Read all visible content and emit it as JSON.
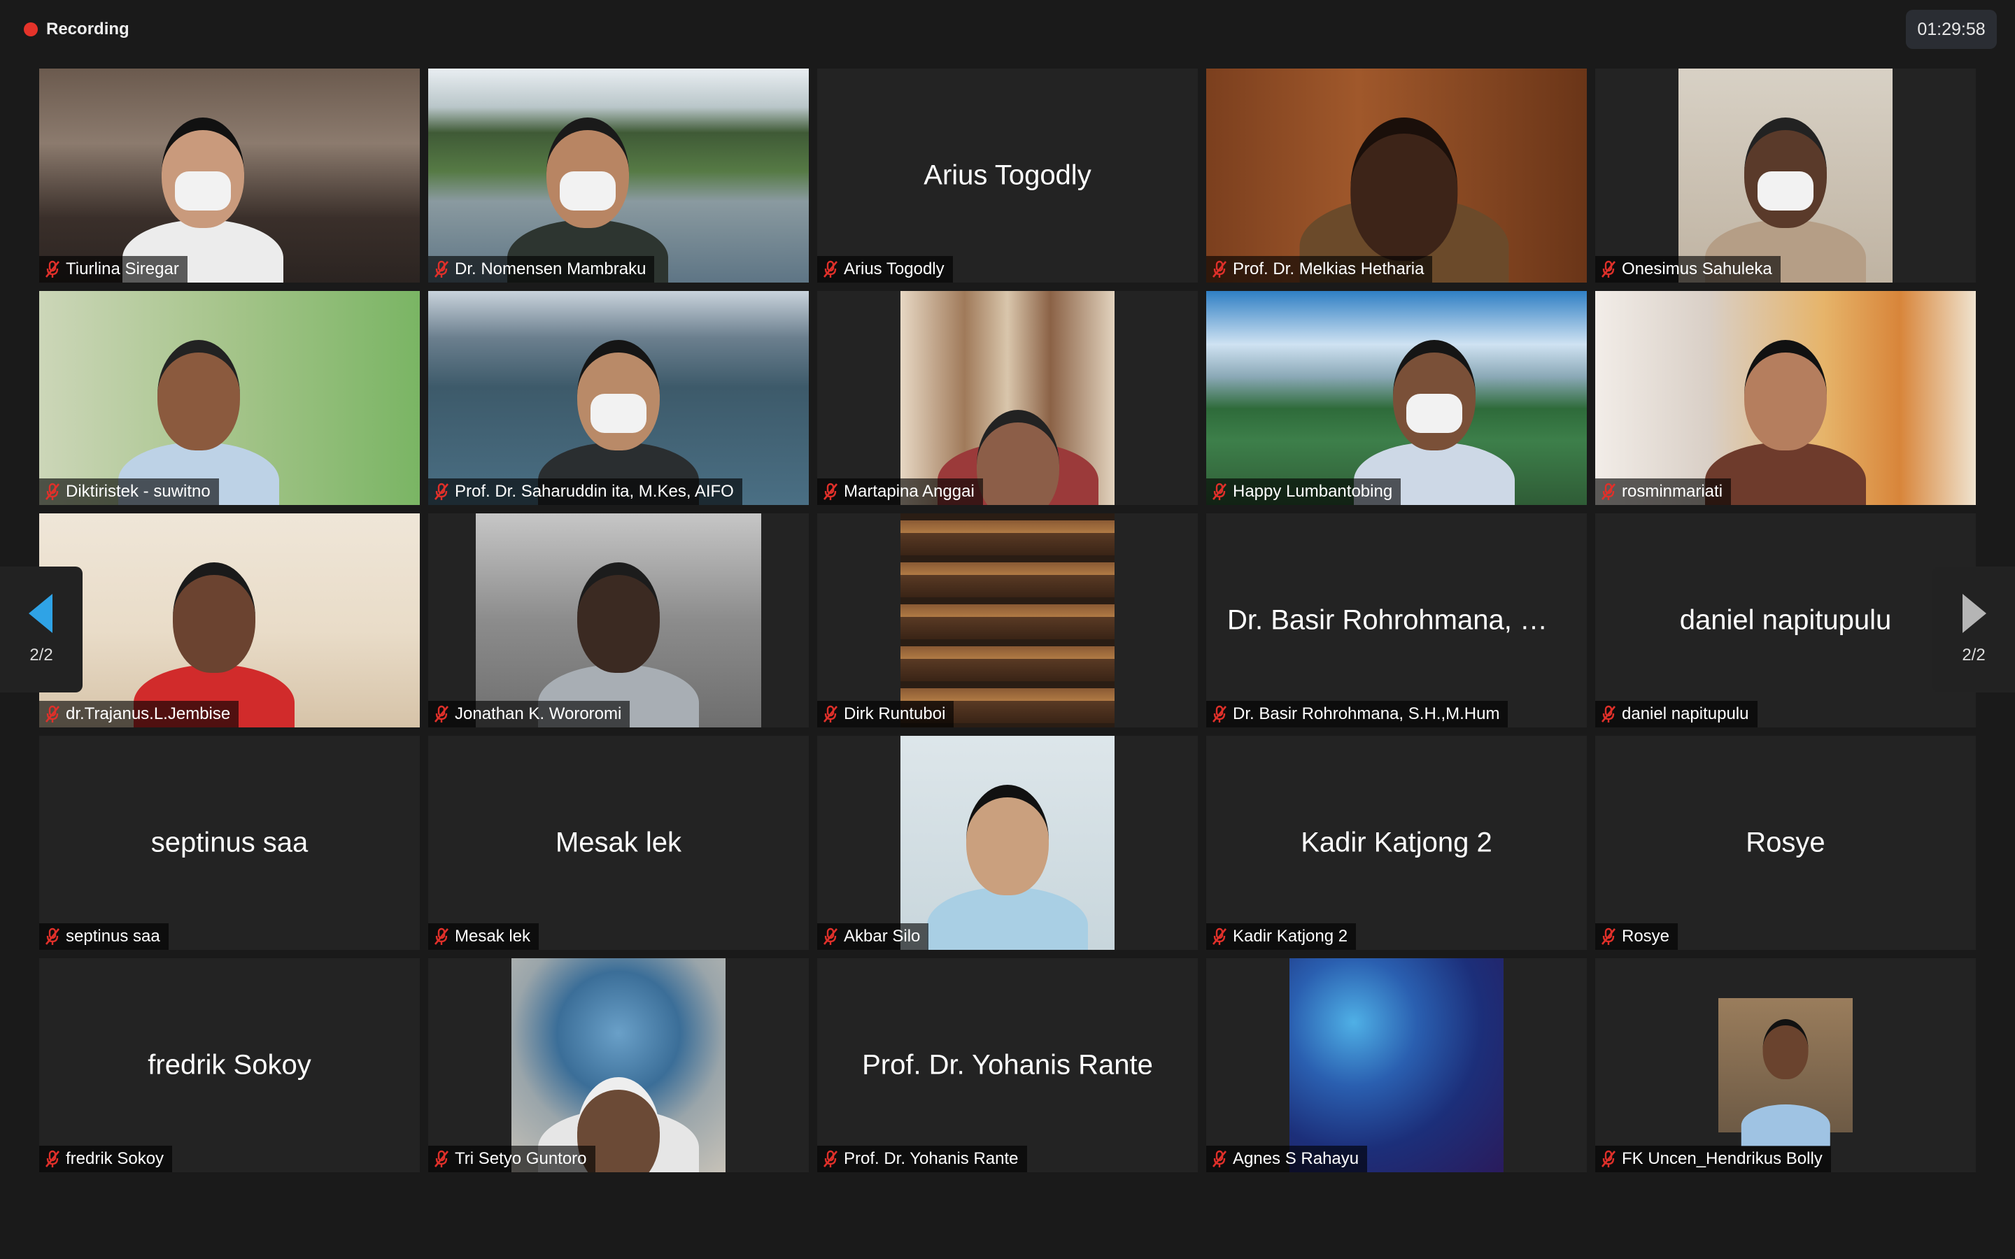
{
  "recording": {
    "label": "Recording",
    "color": "#e5332a"
  },
  "timer": "01:29:58",
  "mic_icon": "muted-mic-icon",
  "mic_color": "#e0302a",
  "pagination": {
    "left_label": "2/2",
    "right_label": "2/2",
    "left_arrow_color": "#2fa3e6",
    "right_arrow_color": "#b5b5b5"
  },
  "participants": [
    {
      "name": "Tiurlina Siregar",
      "video": true,
      "scene": "meeting-room",
      "masked": true
    },
    {
      "name": "Dr. Nomensen Mambraku",
      "video": true,
      "scene": "bay-landscape",
      "masked": true
    },
    {
      "name": "Arius Togodly",
      "display": "Arius Togodly",
      "video": false
    },
    {
      "name": "Prof. Dr. Melkias Hetharia",
      "video": true,
      "scene": "wood-room",
      "masked": false
    },
    {
      "name": "Onesimus Sahuleka",
      "video": true,
      "scene": "portrait-room",
      "masked": true
    },
    {
      "name": "Diktiristek - suwitno",
      "video": true,
      "scene": "green-room",
      "masked": false
    },
    {
      "name": "Prof. Dr. Saharuddin ita, M.Kes, AIFO",
      "video": true,
      "scene": "red-bridge",
      "masked": true
    },
    {
      "name": "Martapina Anggai",
      "video": true,
      "scene": "portrait-curtain",
      "masked": false
    },
    {
      "name": "Happy Lumbantobing",
      "video": true,
      "scene": "lake-landscape",
      "masked": true
    },
    {
      "name": "rosminmariati",
      "video": true,
      "scene": "curtain-room",
      "masked": false
    },
    {
      "name": "dr.Trajanus.L.Jembise",
      "video": true,
      "scene": "flowers-room",
      "masked": false
    },
    {
      "name": "Jonathan K. Wororomi",
      "video": true,
      "scene": "clouds-wall",
      "masked": false
    },
    {
      "name": "Dirk Runtuboi",
      "video": true,
      "scene": "bookshelf",
      "masked": false
    },
    {
      "name": "Dr. Basir Rohrohmana, S.H.,M.Hum",
      "display": "Dr. Basir Rohrohmana, S.H.,...",
      "video": false
    },
    {
      "name": "daniel napitupulu",
      "display": "daniel napitupulu",
      "video": false
    },
    {
      "name": "septinus saa",
      "display": "septinus saa",
      "video": false
    },
    {
      "name": "Mesak lek",
      "display": "Mesak lek",
      "video": false
    },
    {
      "name": "Akbar Silo",
      "video": true,
      "scene": "portrait-photo",
      "masked": false
    },
    {
      "name": "Kadir Katjong 2",
      "display": "Kadir Katjong 2",
      "video": false
    },
    {
      "name": "Rosye",
      "display": "Rosye",
      "video": false
    },
    {
      "name": "fredrik Sokoy",
      "display": "fredrik Sokoy",
      "video": false
    },
    {
      "name": "Tri Setyo Guntoro",
      "video": true,
      "scene": "universal-globe",
      "masked": false
    },
    {
      "name": "Prof. Dr. Yohanis Rante",
      "display": "Prof. Dr. Yohanis Rante",
      "video": false
    },
    {
      "name": "Agnes S Rahayu",
      "video": true,
      "scene": "galaxy",
      "masked": false
    },
    {
      "name": "FK Uncen_Hendrikus Bolly",
      "video": true,
      "scene": "small-photo",
      "masked": false
    }
  ]
}
